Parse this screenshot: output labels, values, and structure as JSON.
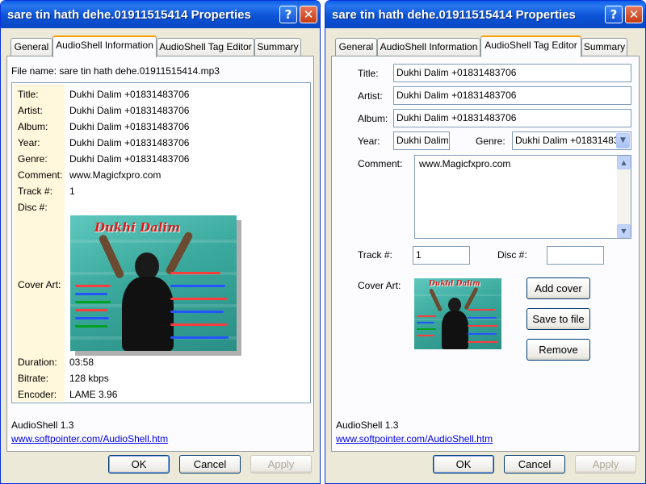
{
  "window_title": "sare tin hath dehe.01911515414 Properties",
  "titlebar_buttons": {
    "help": "?",
    "close": "✕"
  },
  "tabs": {
    "general": "General",
    "info": "AudioShell Information",
    "tag_editor": "AudioShell Tag Editor",
    "summary": "Summary"
  },
  "info": {
    "file_name": "File name: sare tin hath dehe.01911515414.mp3",
    "rows": [
      {
        "label": "Title:",
        "value": "Dukhi Dalim +01831483706"
      },
      {
        "label": "Artist:",
        "value": "Dukhi Dalim +01831483706"
      },
      {
        "label": "Album:",
        "value": "Dukhi Dalim +01831483706"
      },
      {
        "label": "Year:",
        "value": "Dukhi Dalim +01831483706"
      },
      {
        "label": "Genre:",
        "value": "Dukhi Dalim +01831483706"
      },
      {
        "label": "Comment:",
        "value": "www.Magicfxpro.com"
      },
      {
        "label": "Track #:",
        "value": "1"
      },
      {
        "label": "Disc #:",
        "value": ""
      }
    ],
    "cover_art_label": "Cover Art:",
    "bottom_rows": [
      {
        "label": "Duration:",
        "value": "03:58"
      },
      {
        "label": "Bitrate:",
        "value": "128 kbps"
      },
      {
        "label": "Encoder:",
        "value": "LAME 3.96"
      }
    ]
  },
  "cover": {
    "title_text": "Dukhi Dalim"
  },
  "editor": {
    "title_label": "Title:",
    "title_value": "Dukhi Dalim +01831483706",
    "artist_label": "Artist:",
    "artist_value": "Dukhi Dalim +01831483706",
    "album_label": "Album:",
    "album_value": "Dukhi Dalim +01831483706",
    "year_label": "Year:",
    "year_value": "Dukhi Dalim -",
    "genre_label": "Genre:",
    "genre_value": "Dukhi Dalim +01831483",
    "comment_label": "Comment:",
    "comment_value": "www.Magicfxpro.com",
    "track_label": "Track #:",
    "track_value": "1",
    "disc_label": "Disc #:",
    "disc_value": "",
    "cover_art_label": "Cover Art:",
    "add_cover": "Add cover",
    "save_to_file": "Save to file",
    "remove": "Remove"
  },
  "footer": {
    "version": "AudioShell 1.3",
    "link": "www.softpointer.com/AudioShell.htm"
  },
  "buttons": {
    "ok": "OK",
    "cancel": "Cancel",
    "apply": "Apply"
  },
  "colors": {
    "title_bar": "#0a5fe8",
    "active_tab_accent": "#ff9c00",
    "link": "#0000ee",
    "window_bg": "#ece9d8"
  }
}
